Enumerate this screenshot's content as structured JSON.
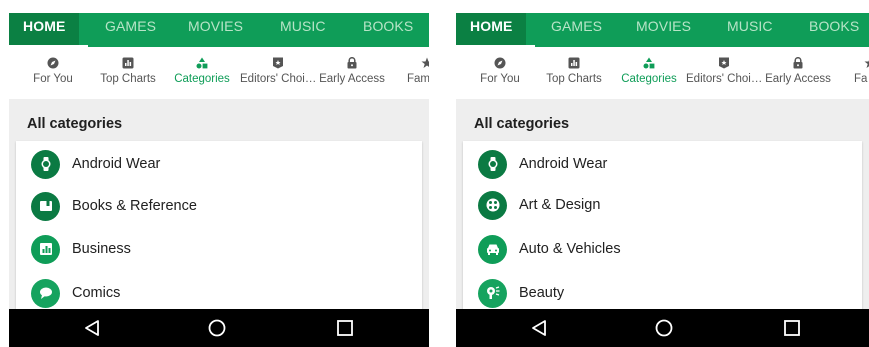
{
  "screens": [
    {
      "top_tabs": [
        "HOME",
        "GAMES",
        "MOVIES",
        "MUSIC",
        "BOOKS"
      ],
      "sub_tabs": [
        "For You",
        "Top Charts",
        "Categories",
        "Editors' Choi…",
        "Early Access",
        "Fam"
      ],
      "active_sub_tab": "Categories",
      "section_title": "All categories",
      "categories": [
        "Android Wear",
        "Books & Reference",
        "Business",
        "Comics"
      ],
      "category_icons": [
        "watch-icon",
        "book-icon",
        "chart-icon",
        "speech-bubble-icon"
      ]
    },
    {
      "top_tabs": [
        "HOME",
        "GAMES",
        "MOVIES",
        "MUSIC",
        "BOOKS"
      ],
      "sub_tabs": [
        "For You",
        "Top Charts",
        "Categories",
        "Editors' Choi…",
        "Early Access",
        "Fa"
      ],
      "active_sub_tab": "Categories",
      "section_title": "All categories",
      "categories": [
        "Android Wear",
        "Art & Design",
        "Auto & Vehicles",
        "Beauty"
      ],
      "category_icons": [
        "watch-icon",
        "palette-icon",
        "car-icon",
        "hair-dryer-icon"
      ]
    }
  ],
  "colors": {
    "accent_green": "#0f9d58",
    "active_tab_bg": "#0b8043",
    "navbar": "#000000"
  },
  "nav_icons": [
    "back-icon",
    "home-icon",
    "recents-icon"
  ]
}
